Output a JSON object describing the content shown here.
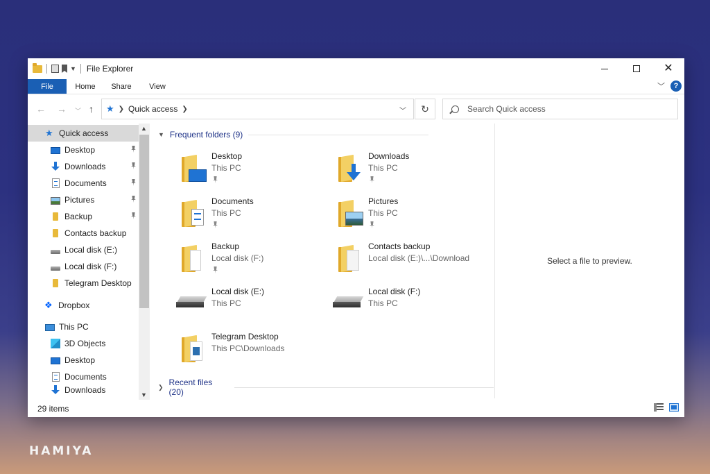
{
  "window": {
    "title": "File Explorer"
  },
  "ribbon": {
    "tabs": [
      "File",
      "Home",
      "Share",
      "View"
    ],
    "help_label": "?"
  },
  "address": {
    "crumb": "Quick access",
    "refresh_icon": "refresh-icon"
  },
  "search": {
    "placeholder": "Search Quick access"
  },
  "nav": {
    "items": [
      {
        "label": "Quick access",
        "icon": "star-icon",
        "pinned": false,
        "selected": true
      },
      {
        "label": "Desktop",
        "icon": "desktop-icon",
        "pinned": true
      },
      {
        "label": "Downloads",
        "icon": "download-icon",
        "pinned": true
      },
      {
        "label": "Documents",
        "icon": "document-icon",
        "pinned": true
      },
      {
        "label": "Pictures",
        "icon": "pictures-icon",
        "pinned": true
      },
      {
        "label": "Backup",
        "icon": "folder-icon",
        "pinned": true
      },
      {
        "label": "Contacts backup",
        "icon": "folder-icon",
        "pinned": false
      },
      {
        "label": "Local disk (E:)",
        "icon": "disk-icon",
        "pinned": false
      },
      {
        "label": "Local disk (F:)",
        "icon": "disk-icon",
        "pinned": false
      },
      {
        "label": "Telegram Desktop",
        "icon": "folder-icon",
        "pinned": false
      },
      {
        "label": "Dropbox",
        "icon": "dropbox-icon",
        "pinned": false
      },
      {
        "label": "This PC",
        "icon": "computer-icon",
        "pinned": false
      },
      {
        "label": "3D Objects",
        "icon": "cube-icon",
        "pinned": false
      },
      {
        "label": "Desktop",
        "icon": "desktop-icon",
        "pinned": false
      },
      {
        "label": "Documents",
        "icon": "document-icon",
        "pinned": false
      },
      {
        "label": "Downloads",
        "icon": "download-icon",
        "pinned": false
      }
    ]
  },
  "content": {
    "frequent_header": "Frequent folders (9)",
    "recent_header": "Recent files (20)",
    "folders": [
      {
        "name": "Desktop",
        "location": "This PC",
        "pinned": true,
        "icon": "desktop-folder-icon"
      },
      {
        "name": "Downloads",
        "location": "This PC",
        "pinned": true,
        "icon": "downloads-folder-icon"
      },
      {
        "name": "Documents",
        "location": "This PC",
        "pinned": true,
        "icon": "documents-folder-icon"
      },
      {
        "name": "Pictures",
        "location": "This PC",
        "pinned": true,
        "icon": "pictures-folder-icon"
      },
      {
        "name": "Backup",
        "location": "Local disk (F:)",
        "pinned": true,
        "icon": "folder-icon"
      },
      {
        "name": "Contacts backup",
        "location": "Local disk (E:)\\...\\Download",
        "pinned": false,
        "icon": "folder-icon"
      },
      {
        "name": "Local disk (E:)",
        "location": "This PC",
        "pinned": false,
        "icon": "disk-icon"
      },
      {
        "name": "Local disk (F:)",
        "location": "This PC",
        "pinned": false,
        "icon": "disk-icon"
      },
      {
        "name": "Telegram Desktop",
        "location": "This PC\\Downloads",
        "pinned": false,
        "icon": "folder-icon"
      }
    ]
  },
  "preview": {
    "text": "Select a file to preview."
  },
  "status": {
    "count": "29 items"
  },
  "brand": {
    "text": "HAMIYA"
  }
}
